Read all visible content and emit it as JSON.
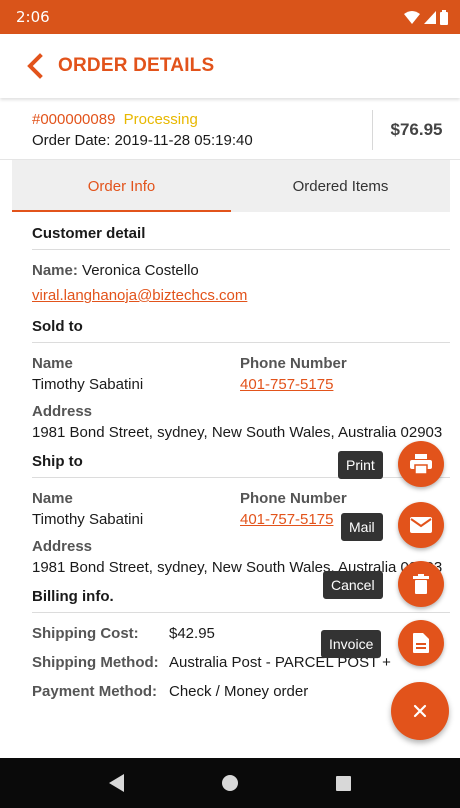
{
  "status_bar": {
    "time": "2:06"
  },
  "app_bar": {
    "title": "ORDER DETAILS"
  },
  "order": {
    "id": "#000000089",
    "status": "Processing",
    "date": "Order Date: 2019-11-28 05:19:40",
    "total": "$76.95"
  },
  "tabs": [
    {
      "label": "Order Info",
      "active": true
    },
    {
      "label": "Ordered Items",
      "active": false
    }
  ],
  "customer": {
    "section_title": "Customer detail",
    "name_label": "Name:",
    "name_value": "Veronica Costello",
    "email": "viral.langhanoja@biztechcs.com"
  },
  "sold_to": {
    "section_title": "Sold to",
    "name_label": "Name",
    "name_value": "Timothy Sabatini",
    "phone_label": "Phone Number",
    "phone_value": "401-757-5175",
    "address_label": "Address",
    "address_value": "1981 Bond Street, sydney, New South Wales, Australia 02903"
  },
  "ship_to": {
    "section_title": "Ship to",
    "name_label": "Name",
    "name_value": "Timothy Sabatini",
    "phone_label": "Phone Number",
    "phone_value": "401-757-5175",
    "address_label": "Address",
    "address_value": "1981 Bond Street, sydney, New South Wales, Australia 02903"
  },
  "billing": {
    "section_title": "Billing info.",
    "shipping_cost_label": "Shipping Cost:",
    "shipping_cost_value": "$42.95",
    "shipping_method_label": "Shipping Method:",
    "shipping_method_value": "Australia Post - PARCEL POST +",
    "payment_method_label": "Payment Method:",
    "payment_method_value": "Check / Money order"
  },
  "fab_menu": {
    "print_label": "Print",
    "mail_label": "Mail",
    "cancel_label": "Cancel",
    "invoice_label": "Invoice",
    "close_icon": "close-icon"
  },
  "colors": {
    "accent": "#e2531b",
    "status_bar": "#d9541a",
    "processing": "#e8b800"
  }
}
